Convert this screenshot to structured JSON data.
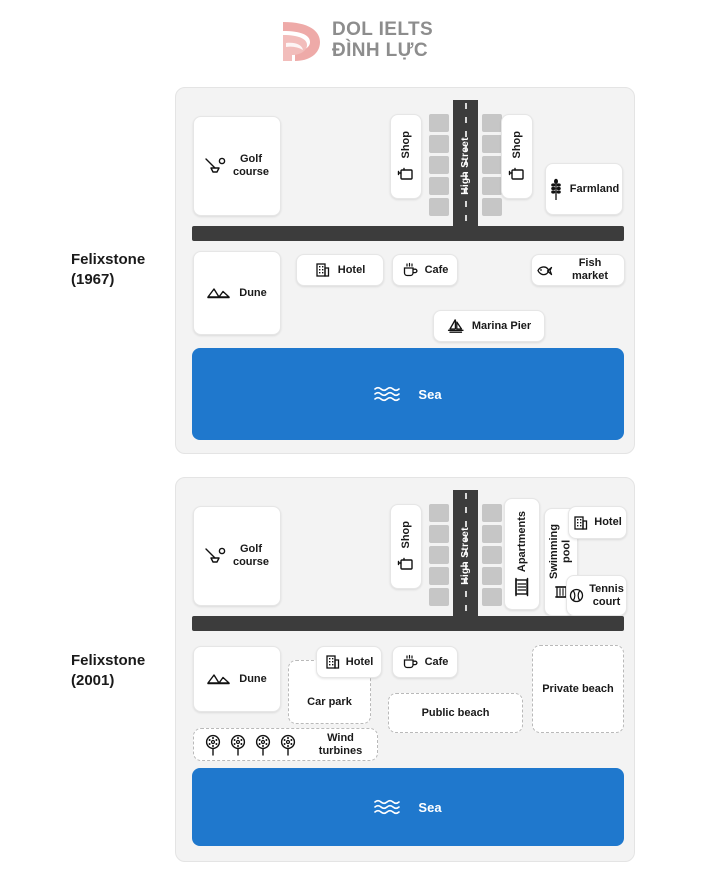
{
  "brand": {
    "line1": "DOL IELTS",
    "line2": "ĐÌNH LỰC",
    "logo_icon": "dol-leaf-logo",
    "logo_color": "#eeaaa8",
    "text_color": "#8d8d8d"
  },
  "colors": {
    "sea": "#1f78cd",
    "road": "#3c3c3c",
    "building_block": "#c6c6c6",
    "map_background": "#f3f3f3",
    "box_background": "#ffffff"
  },
  "maps": [
    {
      "id": "map-1967",
      "label": "Felixstone\n(1967)",
      "road_label": "High Street",
      "sea_label": "Sea",
      "sea_icon": "waves-icon",
      "features": [
        {
          "id": "golf-course",
          "label": "Golf\ncourse",
          "icon": "golf-club-icon"
        },
        {
          "id": "shop-left",
          "label": "Shop",
          "icon": "shopping-bag-icon"
        },
        {
          "id": "shop-right",
          "label": "Shop",
          "icon": "shopping-bag-icon"
        },
        {
          "id": "farmland",
          "label": "Farmland",
          "icon": "wheat-icon"
        },
        {
          "id": "dune",
          "label": "Dune",
          "icon": "mountain-icon"
        },
        {
          "id": "hotel",
          "label": "Hotel",
          "icon": "building-icon"
        },
        {
          "id": "cafe",
          "label": "Cafe",
          "icon": "coffee-cup-icon"
        },
        {
          "id": "fish-market",
          "label": "Fish market",
          "icon": "fish-icon"
        },
        {
          "id": "marina-pier",
          "label": "Marina Pier",
          "icon": "sailboat-icon"
        }
      ]
    },
    {
      "id": "map-2001",
      "label": "Felixstone\n(2001)",
      "road_label": "High Street",
      "sea_label": "Sea",
      "sea_icon": "waves-icon",
      "features": [
        {
          "id": "golf-course",
          "label": "Golf\ncourse",
          "icon": "golf-club-icon"
        },
        {
          "id": "shop-left",
          "label": "Shop",
          "icon": "shopping-bag-icon"
        },
        {
          "id": "apartments",
          "label": "Apartments",
          "icon": "apartment-icon"
        },
        {
          "id": "swimming-pool",
          "label": "Swimming\npool",
          "icon": "pool-building-icon"
        },
        {
          "id": "hotel-top",
          "label": "Hotel",
          "icon": "building-icon"
        },
        {
          "id": "tennis-court",
          "label": "Tennis\ncourt",
          "icon": "tennis-ball-icon"
        },
        {
          "id": "dune",
          "label": "Dune",
          "icon": "mountain-icon"
        },
        {
          "id": "car-park",
          "label": "Car park",
          "icon": "none"
        },
        {
          "id": "hotel-mid",
          "label": "Hotel",
          "icon": "building-icon"
        },
        {
          "id": "cafe",
          "label": "Cafe",
          "icon": "coffee-cup-icon"
        },
        {
          "id": "public-beach",
          "label": "Public beach",
          "icon": "none"
        },
        {
          "id": "private-beach",
          "label": "Private beach",
          "icon": "none"
        },
        {
          "id": "wind-turbines",
          "label": "Wind turbines",
          "icon": "wind-turbine-icon",
          "count": 4
        }
      ]
    }
  ]
}
